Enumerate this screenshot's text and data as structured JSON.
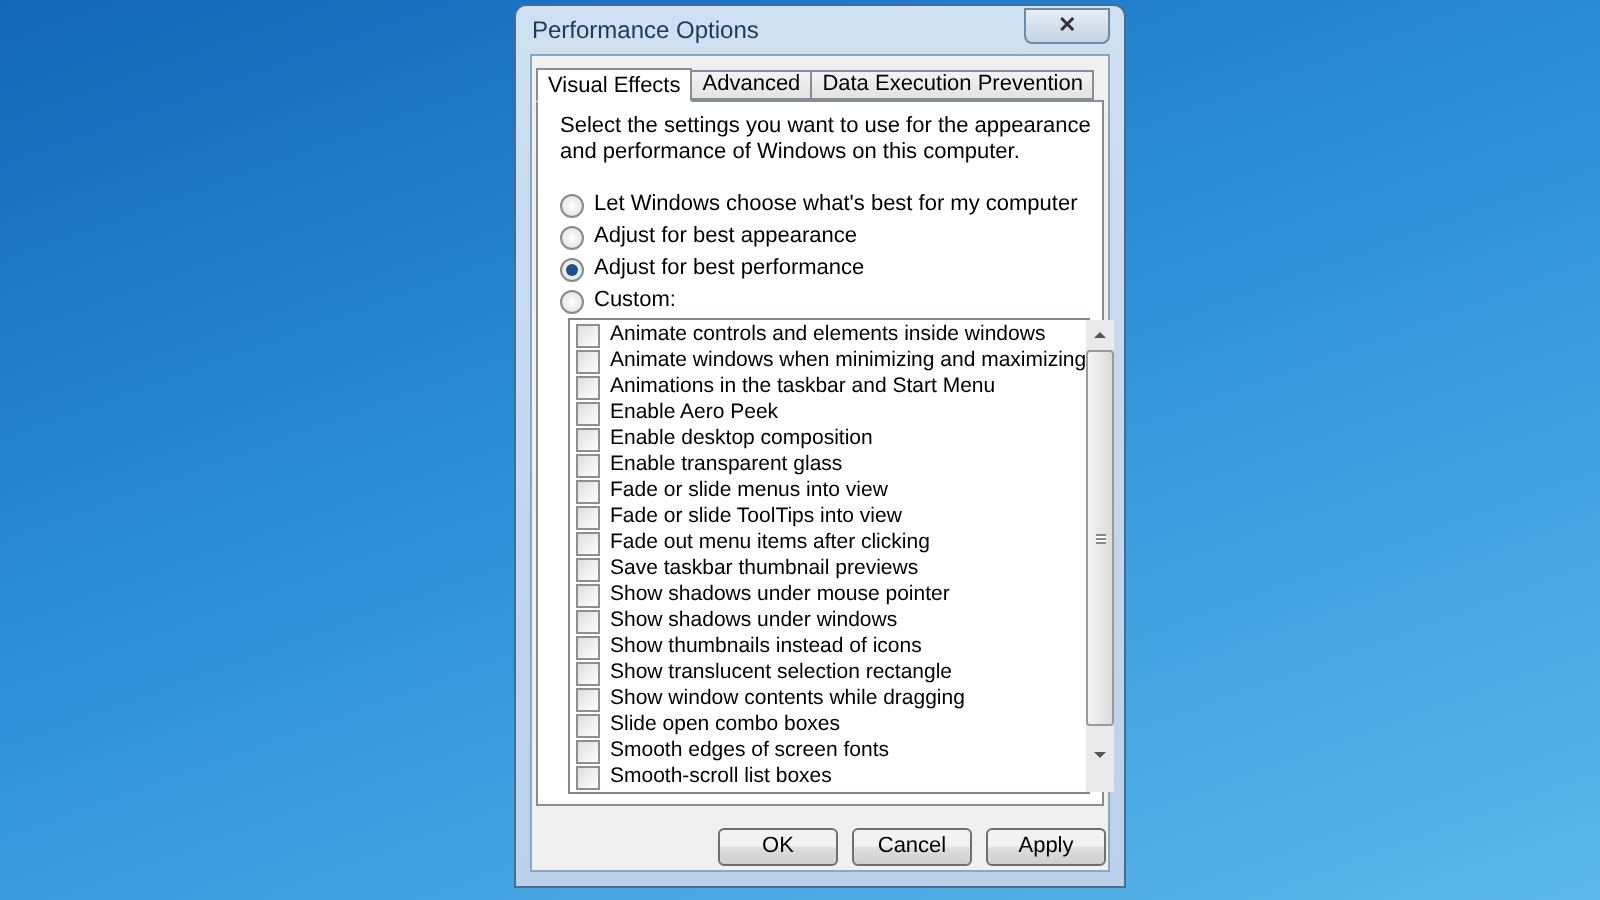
{
  "window": {
    "title": "Performance Options",
    "close": "✕"
  },
  "tabs": [
    {
      "label": "Visual Effects",
      "selected": true
    },
    {
      "label": "Advanced",
      "selected": false
    },
    {
      "label": "Data Execution Prevention",
      "selected": false
    }
  ],
  "description": "Select the settings you want to use for the appearance and performance of Windows on this computer.",
  "options": [
    {
      "label": "Let Windows choose what's best for my computer",
      "selected": false
    },
    {
      "label": "Adjust for best appearance",
      "selected": false
    },
    {
      "label": "Adjust for best performance",
      "selected": true
    },
    {
      "label": "Custom:",
      "selected": false
    }
  ],
  "effects": [
    {
      "label": "Animate controls and elements inside windows",
      "checked": false
    },
    {
      "label": "Animate windows when minimizing and maximizing",
      "checked": false
    },
    {
      "label": "Animations in the taskbar and Start Menu",
      "checked": false
    },
    {
      "label": "Enable Aero Peek",
      "checked": false
    },
    {
      "label": "Enable desktop composition",
      "checked": false
    },
    {
      "label": "Enable transparent glass",
      "checked": false
    },
    {
      "label": "Fade or slide menus into view",
      "checked": false
    },
    {
      "label": "Fade or slide ToolTips into view",
      "checked": false
    },
    {
      "label": "Fade out menu items after clicking",
      "checked": false
    },
    {
      "label": "Save taskbar thumbnail previews",
      "checked": false
    },
    {
      "label": "Show shadows under mouse pointer",
      "checked": false
    },
    {
      "label": "Show shadows under windows",
      "checked": false
    },
    {
      "label": "Show thumbnails instead of icons",
      "checked": false
    },
    {
      "label": "Show translucent selection rectangle",
      "checked": false
    },
    {
      "label": "Show window contents while dragging",
      "checked": false
    },
    {
      "label": "Slide open combo boxes",
      "checked": false
    },
    {
      "label": "Smooth edges of screen fonts",
      "checked": false
    },
    {
      "label": "Smooth-scroll list boxes",
      "checked": false
    }
  ],
  "buttons": [
    "OK",
    "Cancel",
    "Apply"
  ]
}
